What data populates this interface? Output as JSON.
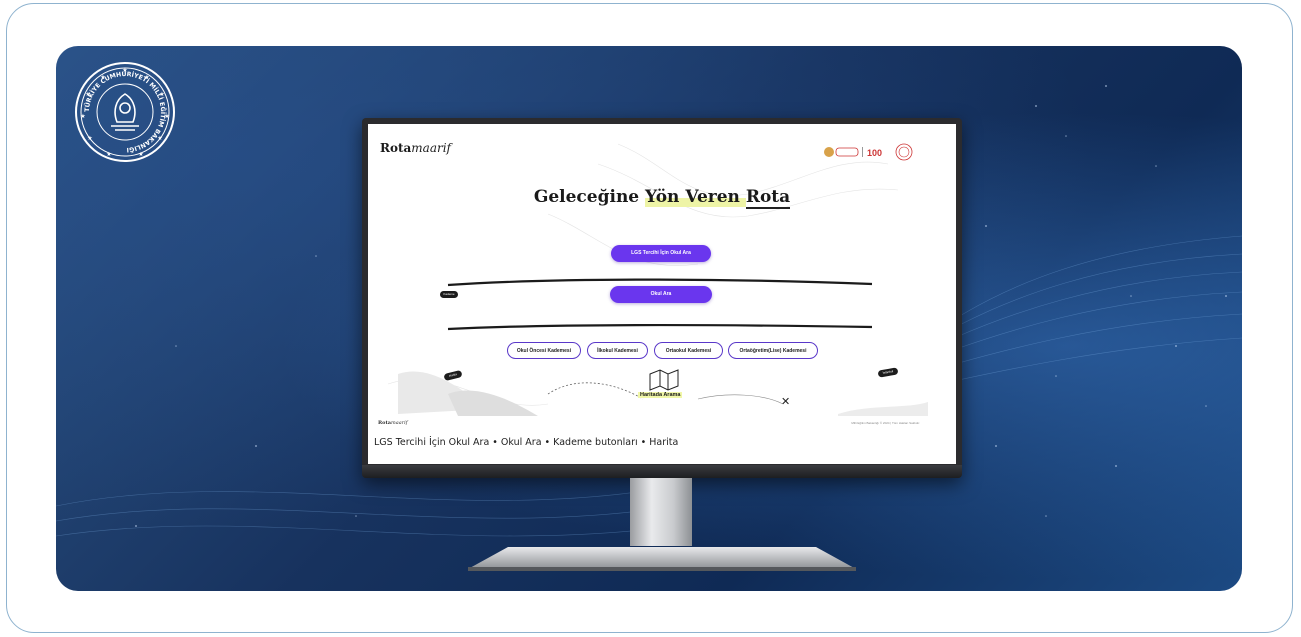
{
  "emblem": {
    "ring_text": "TÜRKİYE CUMHURİYETİ MİLLİ EĞİTİM BAKANLIĞI"
  },
  "screen": {
    "logo_main": "Rota",
    "logo_script": "maarif",
    "headline_pre": "Geleceğine ",
    "headline_mid": "Yön Veren ",
    "headline_last": "Rota",
    "lgs_button": "LGS Tercihi İçin Okul Ara",
    "search_button": "Okul Ara",
    "left_tag": "Kademe",
    "map_left_tag": "Harita",
    "map_right_tag": "İstanbul",
    "levels": [
      "Okul Öncesi Kademesi",
      "İlkokul Kademesi",
      "Ortaokul Kademesi",
      "Ortaöğretim(Lise) Kademesi"
    ],
    "map_label": "Haritada Arama",
    "footer_logo_main": "Rota",
    "footer_logo_script": "maarif",
    "copyright": "Milli Eğitim Bakanlığı © 2024 | Tüm Hakları Saklıdır.",
    "caption": "LGS Tercihi İçin Okul Ara • Okul Ara • Kademe butonları • Harita"
  },
  "colors": {
    "accent": "#6a36ee",
    "backdrop_dark": "#0f2a55",
    "frame_border": "#8fb3cf"
  }
}
